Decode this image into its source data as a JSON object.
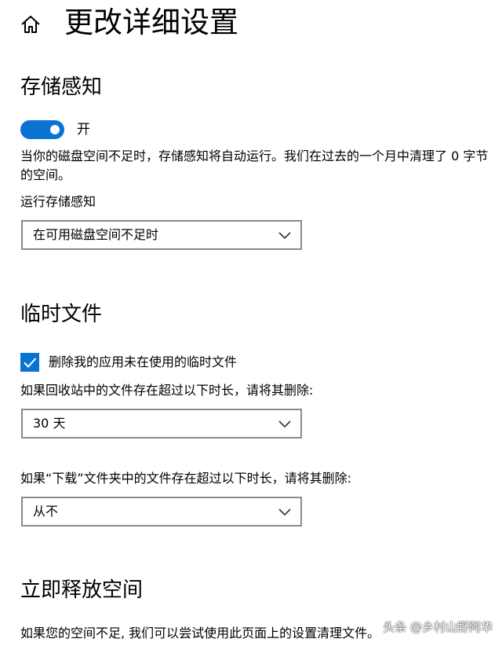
{
  "header": {
    "home_icon": "home-icon",
    "title": "更改详细设置"
  },
  "storage_sense": {
    "title": "存储感知",
    "toggle": {
      "state": "on",
      "label": "开"
    },
    "description": "当你的磁盘空间不足时，存储感知将自动运行。我们在过去的一个月中清理了 0 字节 的空间。",
    "run_label": "运行存储感知",
    "run_value": "在可用磁盘空间不足时"
  },
  "temp_files": {
    "title": "临时文件",
    "checkbox": {
      "checked": true,
      "label": "删除我的应用未在使用的临时文件"
    },
    "recycle_label": "如果回收站中的文件存在超过以下时长，请将其删除:",
    "recycle_value": "30 天",
    "downloads_label": "如果“下载”文件夹中的文件存在超过以下时长，请将其删除:",
    "downloads_value": "从不"
  },
  "free_space": {
    "title": "立即释放空间",
    "description": "如果您的空间不足, 我们可以尝试使用此页面上的设置清理文件。"
  },
  "watermark": "头条 @乡村山野阿华",
  "colors": {
    "accent": "#0a72d2",
    "border": "#8a8a8a"
  }
}
